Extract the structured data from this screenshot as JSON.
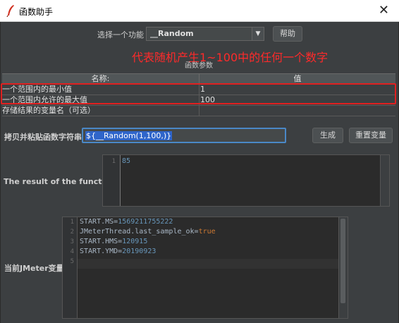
{
  "window": {
    "title": "函数助手",
    "close_glyph": "✕"
  },
  "toolbar": {
    "select_label": "选择一个功能",
    "selected_function": "__Random",
    "help_label": "帮助"
  },
  "annotation": "代表随机产生1~100中的任何一个数字",
  "params": {
    "title": "函数参数",
    "columns": [
      "名称:",
      "值"
    ],
    "rows": [
      {
        "name": "一个范围内的最小值",
        "value": "1"
      },
      {
        "name": "一个范围内允许的最大值",
        "value": "100"
      },
      {
        "name": "存储结果的变量名（可选）",
        "value": ""
      }
    ]
  },
  "function_string": {
    "label": "拷贝并粘贴函数字符串",
    "value": "${__Random(1,100,)}",
    "generate_label": "生成",
    "reset_label": "重置变量"
  },
  "result": {
    "label": "The result of the function is",
    "lines": [
      {
        "no": "1",
        "text": "85"
      }
    ]
  },
  "jmeter_vars": {
    "label": "当前JMeter变量",
    "lines": [
      {
        "no": "1",
        "key": "START.MS=",
        "value": "1569211755222",
        "kind": "num"
      },
      {
        "no": "2",
        "key": "JMeterThread.last_sample_ok=",
        "value": "true",
        "kind": "kw"
      },
      {
        "no": "3",
        "key": "START.HMS=",
        "value": "120915",
        "kind": "num"
      },
      {
        "no": "4",
        "key": "START.YMD=",
        "value": "20190923",
        "kind": "num"
      },
      {
        "no": "5",
        "key": "",
        "value": "",
        "kind": "num"
      }
    ]
  },
  "colors": {
    "annotation": "#ff2a2a",
    "highlight_box": "#e02020",
    "number": "#6897bb",
    "keyword": "#cc7832"
  }
}
